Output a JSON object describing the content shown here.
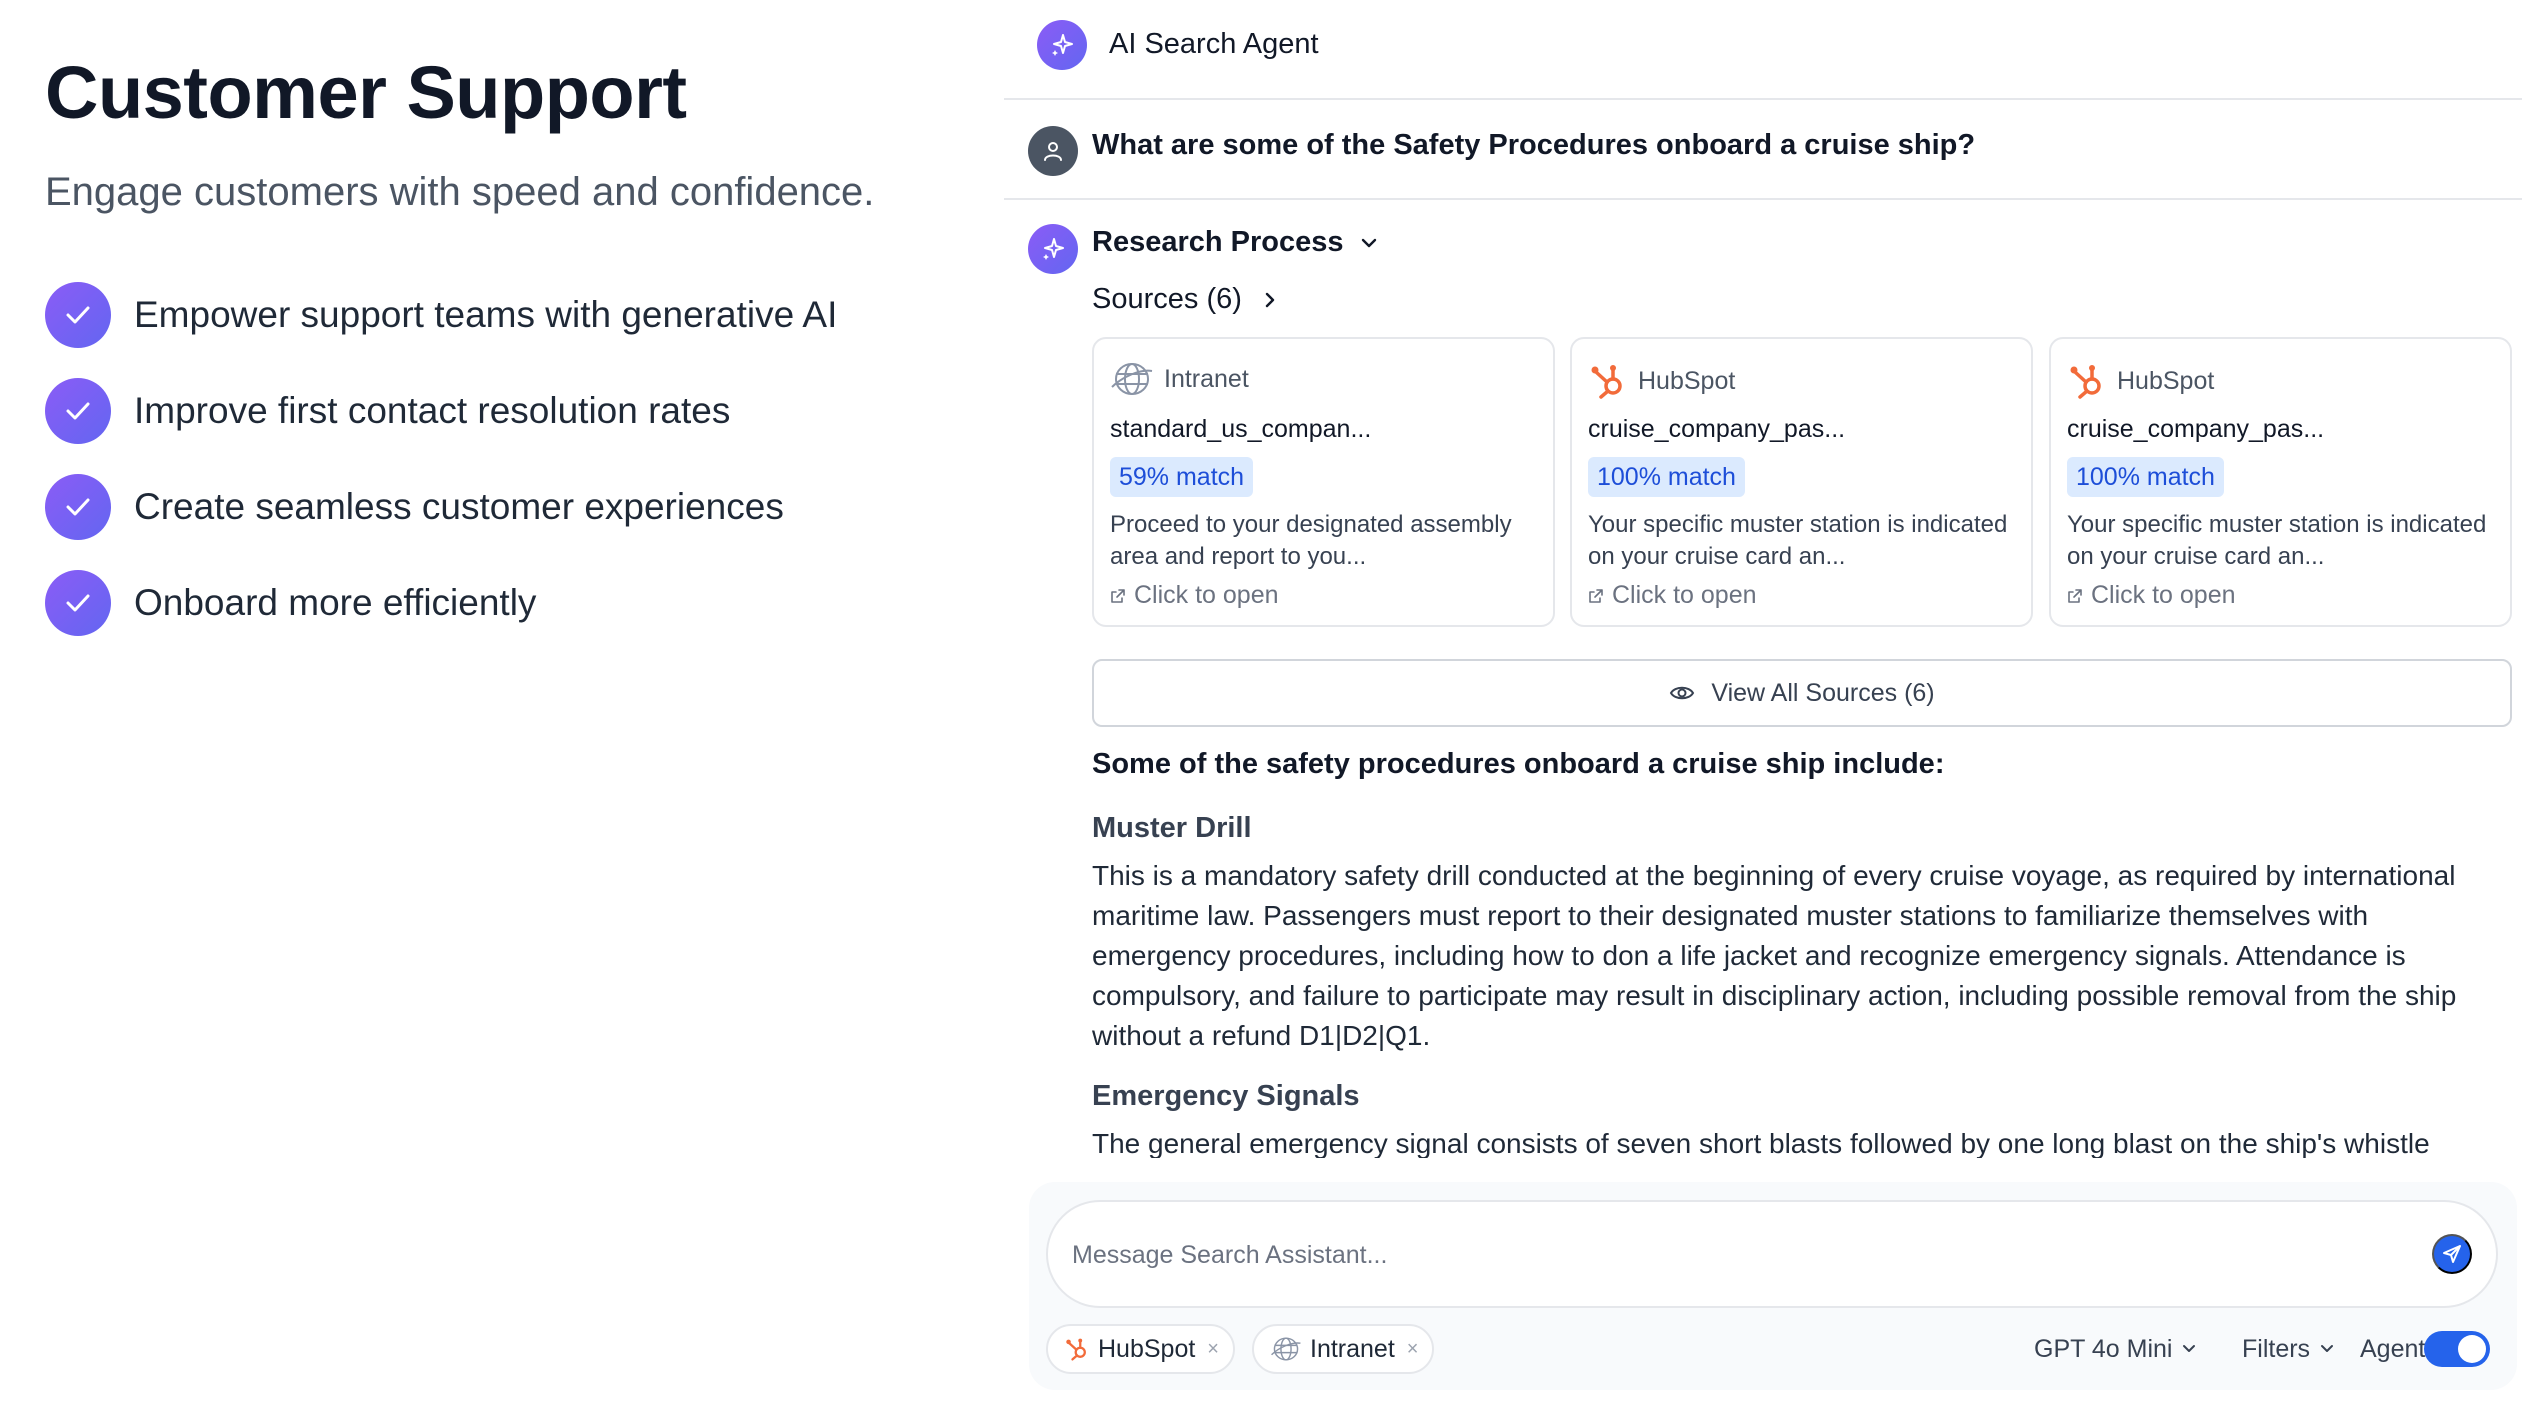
{
  "hero": {
    "title": "Customer Support",
    "subtitle": "Engage customers with speed and confidence.",
    "features": [
      "Empower support teams with generative AI",
      "Improve first contact resolution rates",
      "Create seamless customer experiences",
      "Onboard more efficiently"
    ]
  },
  "colors": {
    "accent_gradient_start": "#8b5cf6",
    "accent_gradient_end": "#6366f1",
    "match_badge_bg": "#dbeafe",
    "match_badge_text": "#1d4ed8",
    "hubspot_orange": "#f26b3a",
    "send_button": "#2563eb"
  },
  "agent": {
    "title": "AI Search Agent",
    "icon": "sparkle-icon"
  },
  "conversation": {
    "question": "What are some of the Safety Procedures onboard a cruise ship?",
    "research_title": "Research Process",
    "sources_label": "Sources (6)",
    "sources": [
      {
        "provider": "Intranet",
        "icon": "globe-icon",
        "file": "standard_us_compan...",
        "match": "59% match",
        "snippet": "Proceed to your designated assembly area and report to you...",
        "open_label": "Click to open"
      },
      {
        "provider": "HubSpot",
        "icon": "hubspot-icon",
        "file": "cruise_company_pas...",
        "match": "100% match",
        "snippet": "Your specific muster station is indicated on your cruise card an...",
        "open_label": "Click to open"
      },
      {
        "provider": "HubSpot",
        "icon": "hubspot-icon",
        "file": "cruise_company_pas...",
        "match": "100% match",
        "snippet": "Your specific muster station is indicated on your cruise card an...",
        "open_label": "Click to open"
      }
    ],
    "view_all_label": "View All Sources (6)",
    "answer": {
      "intro": "Some of the safety procedures onboard a cruise ship include:",
      "sections": [
        {
          "heading": "Muster Drill",
          "body": "This is a mandatory safety drill conducted at the beginning of every cruise voyage, as required by international maritime law. Passengers must report to their designated muster stations to familiarize themselves with emergency procedures, including how to don a life jacket and recognize emergency signals. Attendance is compulsory, and failure to participate may result in disciplinary action, including possible removal from the ship without a refund D1|D2|Q1."
        },
        {
          "heading": "Emergency Signals",
          "body": "The general emergency signal consists of seven short blasts followed by one long blast on the ship's whistle"
        }
      ]
    }
  },
  "composer": {
    "placeholder": "Message Search Assistant...",
    "chips": [
      {
        "label": "HubSpot",
        "icon": "hubspot-icon"
      },
      {
        "label": "Intranet",
        "icon": "globe-icon"
      }
    ],
    "model_label": "GPT 4o Mini",
    "filters_label": "Filters",
    "agent_label": "Agent",
    "agent_enabled": true
  }
}
